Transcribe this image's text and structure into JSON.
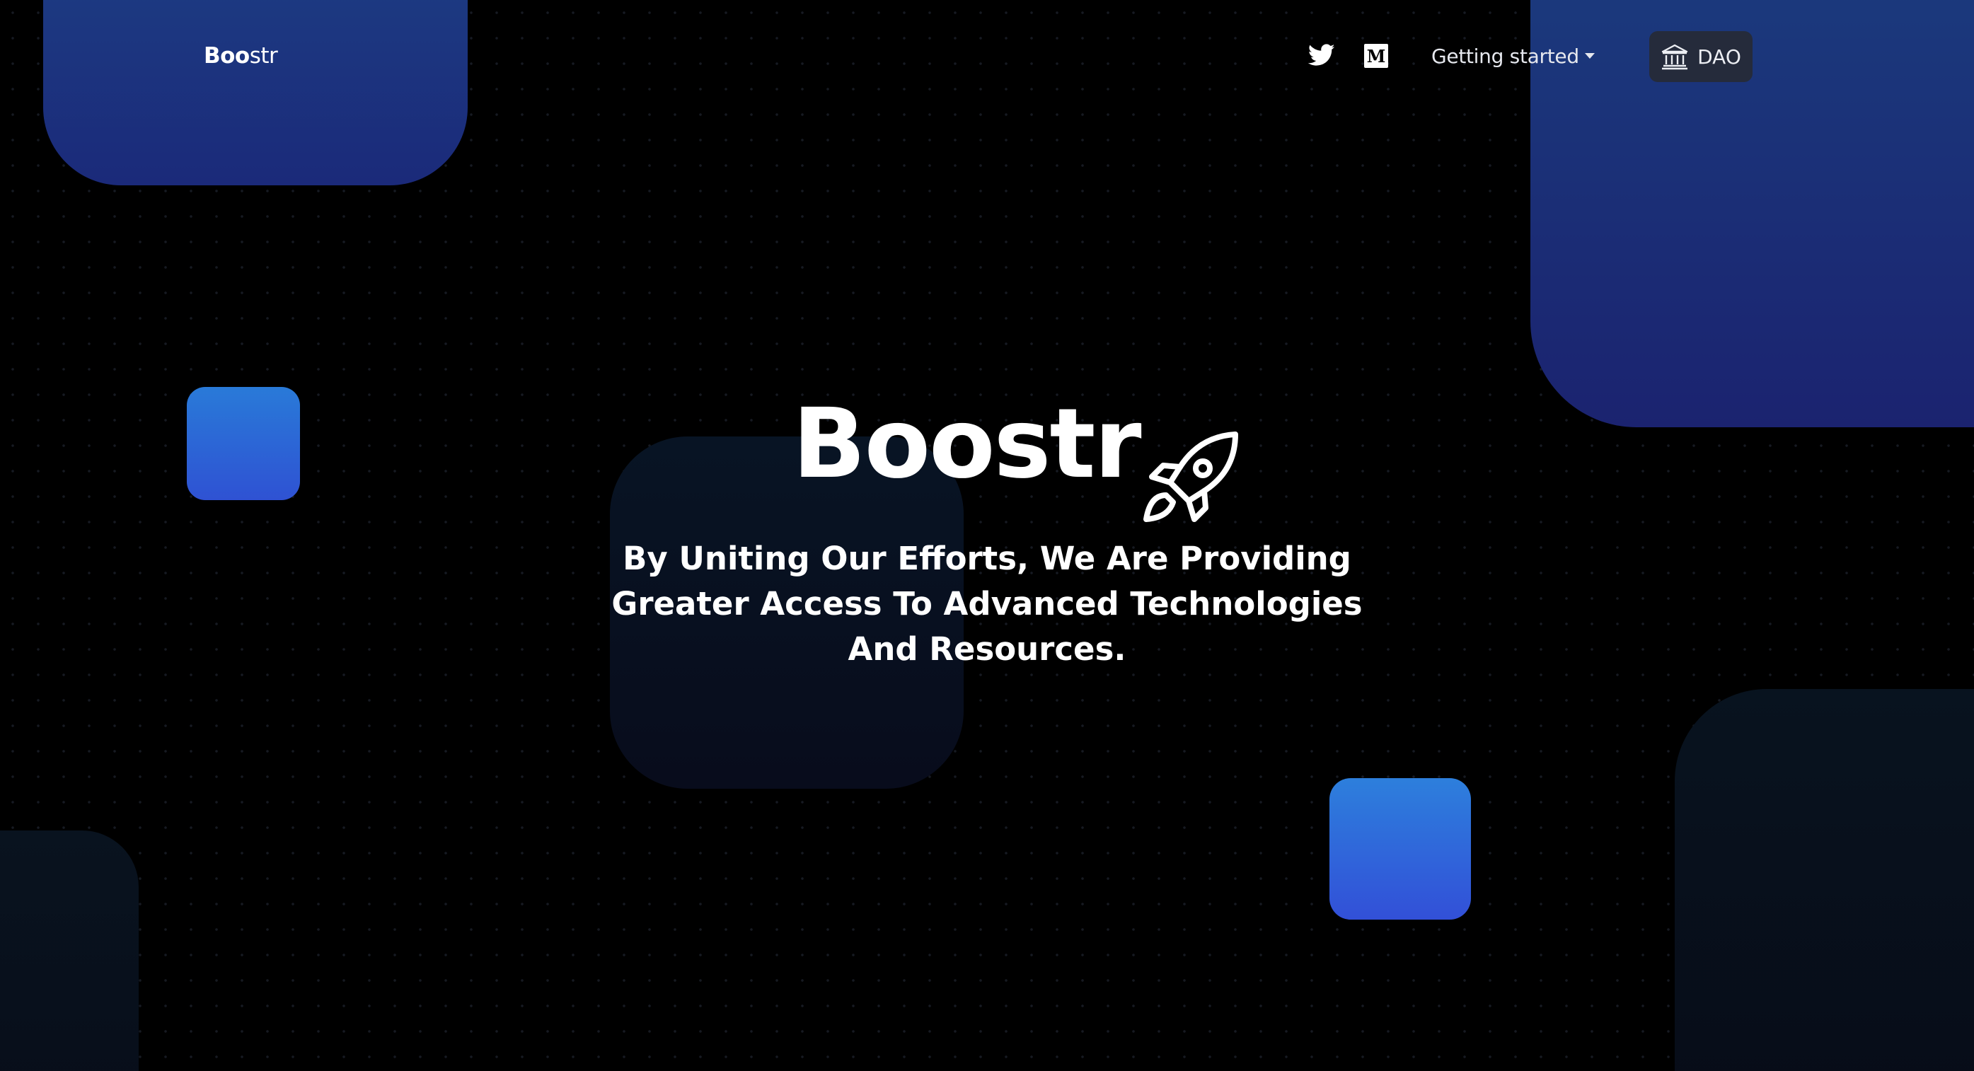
{
  "header": {
    "logo_bold": "Boo",
    "logo_light": "str",
    "twitter_icon": "twitter-icon",
    "medium_icon": "medium-icon",
    "getting_started_label": "Getting started",
    "dao_label": "DAO",
    "dao_icon": "bank-icon"
  },
  "hero": {
    "title": "Boostr",
    "title_icon": "rocket-icon",
    "subtitle": "By Uniting Our Efforts, We Are Providing Greater Access To Advanced Technologies And Resources."
  },
  "colors": {
    "background": "#000000",
    "accent_blue": "#2f6ad8",
    "navy": "#1b2a7a",
    "dao_button_bg": "#252b3b"
  }
}
